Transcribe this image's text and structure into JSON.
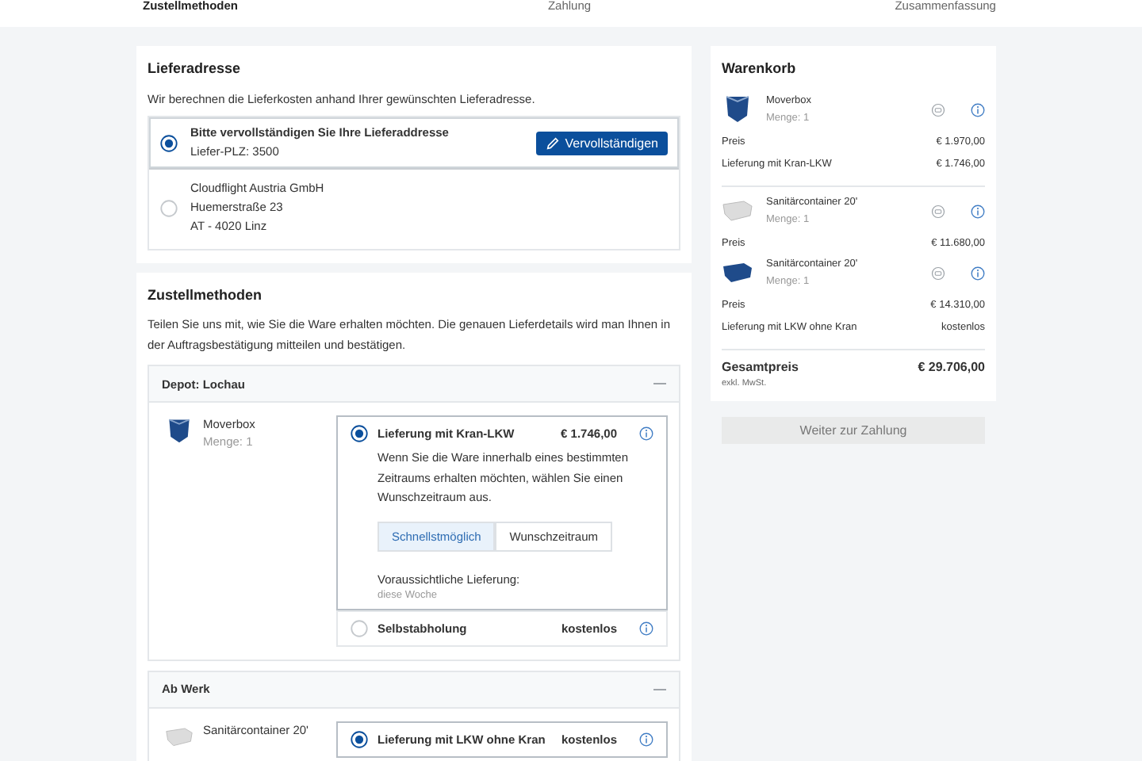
{
  "stepper": [
    {
      "label": "Zustellmethoden",
      "selected": true
    },
    {
      "label": "Zahlung",
      "selected": false
    },
    {
      "label": "Zusammenfassung",
      "selected": false
    }
  ],
  "delivery_address": {
    "title": "Lieferadresse",
    "intro": "Wir berechnen die Lieferkosten anhand Ihrer gewünschten Lieferadresse.",
    "options": [
      {
        "kind": "incomplete",
        "selected": true,
        "title": "Bitte vervollständigen Sie Ihre Lieferaddresse",
        "lines": [
          "Liefer-PLZ: 3500"
        ],
        "button": "Vervollständigen"
      },
      {
        "kind": "address",
        "selected": false,
        "lines": [
          "Cloudflight Austria GmbH",
          "Huemerstraße 23",
          "AT - 4020 Linz"
        ]
      }
    ]
  },
  "shipping": {
    "title": "Zustellmethoden",
    "intro": "Teilen Sie uns mit, wie Sie die Ware erhalten möchten. Die genauen Lieferdetails wird man Ihnen in der Auftragsbestätigung mitteilen und bestätigen.",
    "groups": [
      {
        "name": "Depot: Lochau",
        "expanded": true,
        "items": [
          {
            "kind": "box",
            "product": "Moverbox",
            "quantity": "Menge: 1",
            "options": [
              {
                "label": "Lieferung mit Kran-LKW",
                "price": "€ 1.746,00",
                "selected": true,
                "description": "Wenn Sie die Ware innerhalb eines bestimmten Zeitraums erhalten möchten, wählen Sie einen Wunschzeitraum aus.",
                "toggle": [
                  {
                    "label": "Schnellstmöglich",
                    "selected": true
                  },
                  {
                    "label": "Wunschzeitraum",
                    "selected": false
                  }
                ],
                "estimate_label": "Voraussichtliche Lieferung:",
                "estimate": "diese Woche"
              },
              {
                "label": "Selbstabholung",
                "price": "kostenlos",
                "selected": false
              }
            ]
          }
        ]
      },
      {
        "name": "Ab Werk",
        "expanded": true,
        "items": [
          {
            "kind": "container",
            "product": "Sanitärcontainer 20'",
            "options": [
              {
                "label": "Lieferung mit LKW ohne Kran",
                "price": "kostenlos",
                "selected": true
              }
            ]
          }
        ]
      }
    ]
  },
  "cart": {
    "title": "Warenkorb",
    "items": [
      {
        "kind": "box",
        "name": "Moverbox",
        "quantity": "Menge: 1",
        "lines": [
          {
            "label": "Preis",
            "value": "€ 1.970,00"
          },
          {
            "label": "Lieferung mit Kran-LKW",
            "value": "€ 1.746,00"
          }
        ]
      },
      {
        "kind": "container",
        "name": "Sanitärcontainer 20'",
        "quantity": "Menge: 1",
        "lines": [
          {
            "label": "Preis",
            "value": "€ 11.680,00"
          }
        ]
      },
      {
        "kind": "bluecontainer",
        "name": "Sanitärcontainer 20'",
        "quantity": "Menge: 1",
        "lines": [
          {
            "label": "Preis",
            "value": "€ 14.310,00"
          },
          {
            "label": "Lieferung mit LKW ohne Kran",
            "value": "kostenlos"
          }
        ]
      }
    ],
    "total_label": "Gesamtpreis",
    "total": "€ 29.706,00",
    "tax_note": "exkl. MwSt.",
    "button": {
      "label": "Weiter zur Zahlung",
      "disabled": true
    }
  }
}
